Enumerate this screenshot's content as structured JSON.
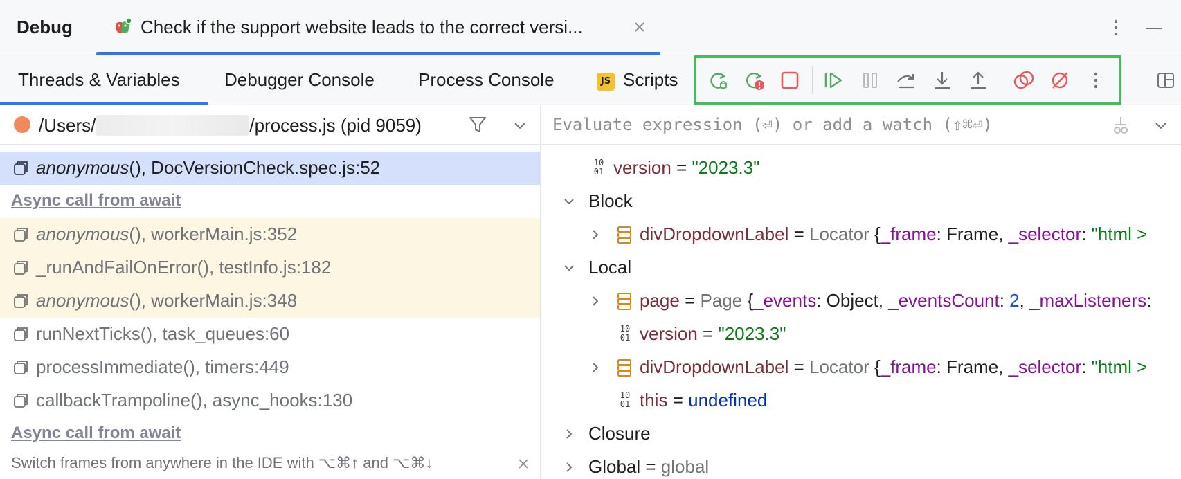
{
  "titlebar": {
    "title": "Debug",
    "tab_label": "Check if the support website leads to the correct versi...",
    "tab_icon": "playwright-test-icon",
    "close_icon": "close-icon",
    "more_icon": "more-vertical-icon",
    "minimize_icon": "minimize-icon"
  },
  "tabs": [
    {
      "label": "Threads & Variables",
      "active": true
    },
    {
      "label": "Debugger Console",
      "active": false
    },
    {
      "label": "Process Console",
      "active": false
    },
    {
      "label": "Scripts",
      "active": false,
      "badge": "JS"
    }
  ],
  "toolbar": {
    "buttons": [
      "rerun-test-icon",
      "rerun-failed-icon",
      "stop-icon",
      "resume-icon",
      "pause-icon",
      "step-over-icon",
      "step-into-icon",
      "step-out-icon",
      "view-breakpoints-icon",
      "mute-breakpoints-icon",
      "more-vertical-icon"
    ],
    "highlight_color": "#4cb860"
  },
  "process": {
    "path_prefix": "/Users/",
    "path_suffix": "/process.js (pid 9059)",
    "status_color": "#f08a5d"
  },
  "frames": {
    "selected": {
      "fn": "anonymous",
      "rest": "(), DocVersionCheck.spec.js:52"
    },
    "async1": "Async call from await",
    "lib": [
      {
        "fn": "anonymous",
        "italic": true,
        "rest": "(), workerMain.js:352"
      },
      {
        "fn": "_runAndFailOnError",
        "italic": false,
        "rest": "(), testInfo.js:182"
      },
      {
        "fn": "anonymous",
        "italic": true,
        "rest": "(), workerMain.js:348"
      }
    ],
    "internal": [
      {
        "fn": "runNextTicks",
        "rest": "(), task_queues:60"
      },
      {
        "fn": "processImmediate",
        "rest": "(), timers:449"
      },
      {
        "fn": "callbackTrampoline",
        "rest": "(), async_hooks:130"
      }
    ],
    "async2": "Async call from await"
  },
  "hint": "Switch frames from anywhere in the IDE with ⌥⌘↑ and ⌥⌘↓",
  "evaluate": {
    "placeholder": "Evaluate expression (⏎) or add a watch (⇧⌘⏎)"
  },
  "variables": {
    "top_version": {
      "name": "version",
      "value": "\"2023.3\""
    },
    "block_label": "Block",
    "block_item": {
      "name": "divDropdownLabel",
      "eq": " = ",
      "type": "Locator",
      "brace": " {",
      "f1": "_frame",
      "v1": ": Frame, ",
      "f2": "_selector",
      "v2": ": ",
      "s2": "\"html >"
    },
    "local_label": "Local",
    "page": {
      "name": "page",
      "eq": " = ",
      "type": "Page",
      "brace": " {",
      "f1": "_events",
      "v1": ": Object, ",
      "f2": "_eventsCount",
      "v2": ": ",
      "n2": "2",
      "comma": ", ",
      "f3": "_maxListeners",
      "v3": ":"
    },
    "local_version": {
      "name": "version",
      "value": "\"2023.3\""
    },
    "local_div": {
      "name": "divDropdownLabel",
      "eq": " = ",
      "type": "Locator",
      "brace": " {",
      "f1": "_frame",
      "v1": ": Frame, ",
      "f2": "_selector",
      "v2": ": ",
      "s2": "\"html >"
    },
    "this_row": {
      "name": "this",
      "value": "undefined"
    },
    "closure_label": "Closure",
    "global_label": "Global",
    "global_value": "global",
    "eq": " = "
  }
}
